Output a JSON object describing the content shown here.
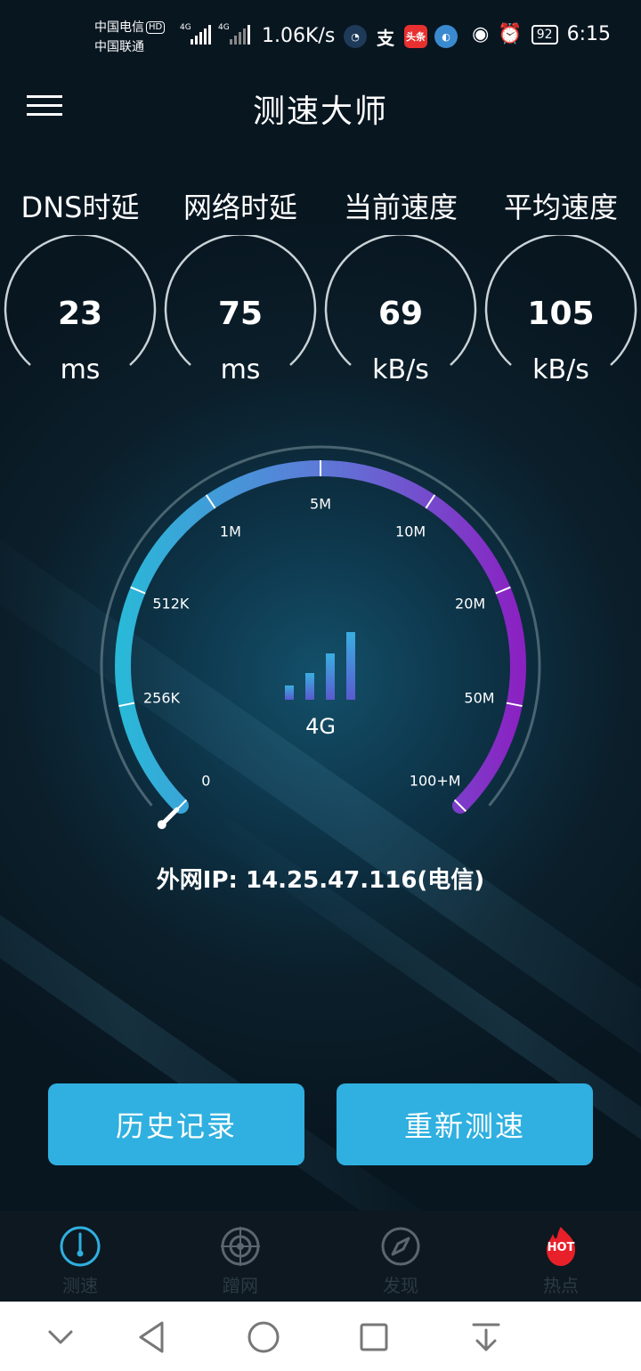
{
  "status_bar": {
    "carrier1": "中国电信",
    "hd_badge": "HD",
    "carrier2": "中国联通",
    "net1": "4G",
    "net2": "4G",
    "speed": "1.06K/s",
    "app_icons": [
      "头条"
    ],
    "battery": "92",
    "time": "6:15"
  },
  "header": {
    "menu_icon": "hamburger-menu-icon",
    "title": "测速大师"
  },
  "stats": [
    {
      "label": "DNS时延",
      "value": "23",
      "unit": "ms"
    },
    {
      "label": "网络时延",
      "value": "75",
      "unit": "ms"
    },
    {
      "label": "当前速度",
      "value": "69",
      "unit": "kB/s"
    },
    {
      "label": "平均速度",
      "value": "105",
      "unit": "kB/s"
    }
  ],
  "gauge": {
    "ticks": [
      "0",
      "256K",
      "512K",
      "1M",
      "5M",
      "10M",
      "20M",
      "50M",
      "100+M"
    ],
    "needle_fraction": 0.0,
    "network_type": "4G",
    "colors": {
      "start": "#2ab8d8",
      "end": "#8a22c2"
    }
  },
  "ip_info": "外网IP: 14.25.47.116(电信)",
  "buttons": {
    "history": "历史记录",
    "retest": "重新测速"
  },
  "bottom_nav": [
    {
      "label": "测速",
      "icon": "speedometer-icon",
      "active": true
    },
    {
      "label": "蹭网",
      "icon": "crosshair-icon",
      "active": false
    },
    {
      "label": "发现",
      "icon": "compass-icon",
      "active": false
    },
    {
      "label": "热点",
      "icon": "hot-flame-icon",
      "active": false,
      "badge": "HOT"
    }
  ],
  "accent_color": "#2fb0e0"
}
